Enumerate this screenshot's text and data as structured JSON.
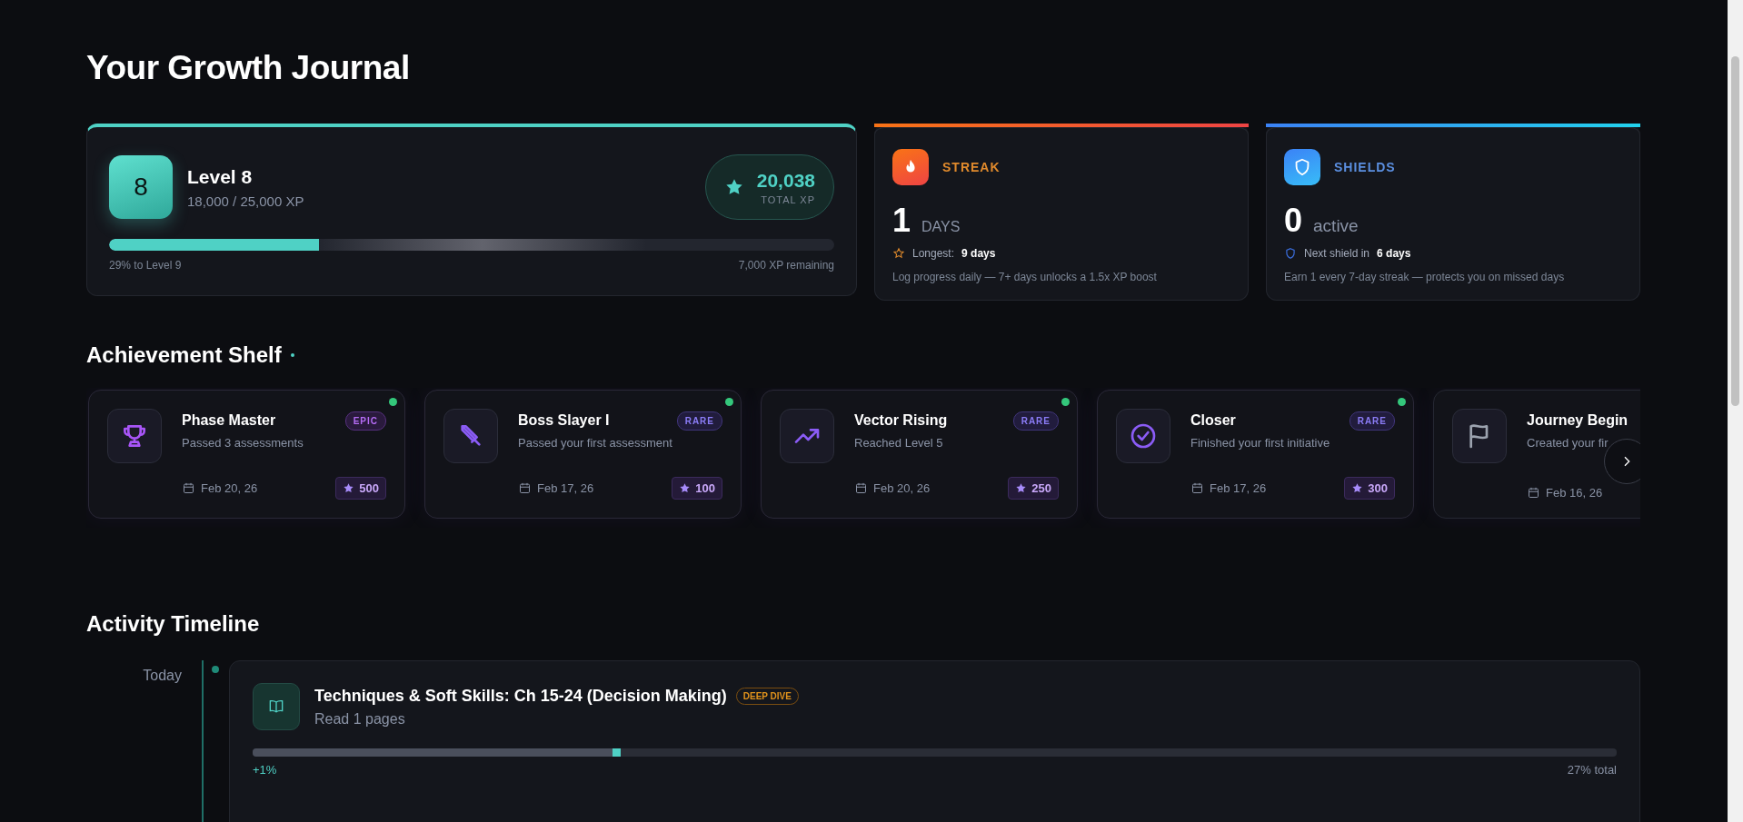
{
  "title": "Your Growth Journal",
  "level_card": {
    "badge": "8",
    "title": "Level 8",
    "xp": "18,000 / 25,000 XP",
    "total_value": "20,038",
    "total_label": "TOTAL XP",
    "level": 0.29,
    "progress_left": "29% to Level 9",
    "progress_right": "7,000 XP remaining"
  },
  "stat_cards": [
    {
      "kind": "streak",
      "label": "STREAK",
      "value": "1",
      "unit": "DAYS",
      "detail_label": "Longest:",
      "detail_value": "9 days",
      "note": "Log progress daily — 7+ days unlocks a 1.5x XP boost"
    },
    {
      "kind": "shields",
      "label": "SHIELDS",
      "value": "0",
      "unit": "active",
      "detail_label": "Next shield in",
      "detail_value": "6 days",
      "note": "Earn 1 every 7-day streak — protects you on missed days"
    }
  ],
  "achievements": {
    "title": "Achievement Shelf",
    "items": [
      {
        "kind": "trophy",
        "color": "#a855f7",
        "title": "Phase Master",
        "description": "Passed 3 assessments",
        "rarity": "EPIC",
        "date": "Feb 20, 26",
        "points": "500",
        "new": true
      },
      {
        "kind": "sword",
        "color": "#8b5cf6",
        "title": "Boss Slayer I",
        "description": "Passed your first assessment",
        "rarity": "RARE",
        "date": "Feb 17, 26",
        "points": "100",
        "new": true
      },
      {
        "kind": "trend",
        "color": "#8b5cf6",
        "title": "Vector Rising",
        "description": "Reached Level 5",
        "rarity": "RARE",
        "date": "Feb 20, 26",
        "points": "250",
        "new": true
      },
      {
        "kind": "check",
        "color": "#8b5cf6",
        "title": "Closer",
        "description": "Finished your first initiative",
        "rarity": "RARE",
        "date": "Feb 17, 26",
        "points": "300",
        "new": true
      },
      {
        "kind": "flag",
        "color": "#9ca3af",
        "title": "Journey Begin",
        "description": "Created your fir",
        "date": "Feb 16, 26"
      }
    ]
  },
  "timeline": {
    "title": "Activity Timeline",
    "groups": [
      {
        "day": "Today",
        "entries": [
          {
            "kind": "book",
            "title": "Techniques & Soft Skills: Ch 15-24 (Decision Making)",
            "tag": "DEEP DIVE",
            "subtitle": "Read 1 pages",
            "level": 0.27,
            "delta": "+1%",
            "total": "27% total"
          }
        ]
      }
    ]
  }
}
